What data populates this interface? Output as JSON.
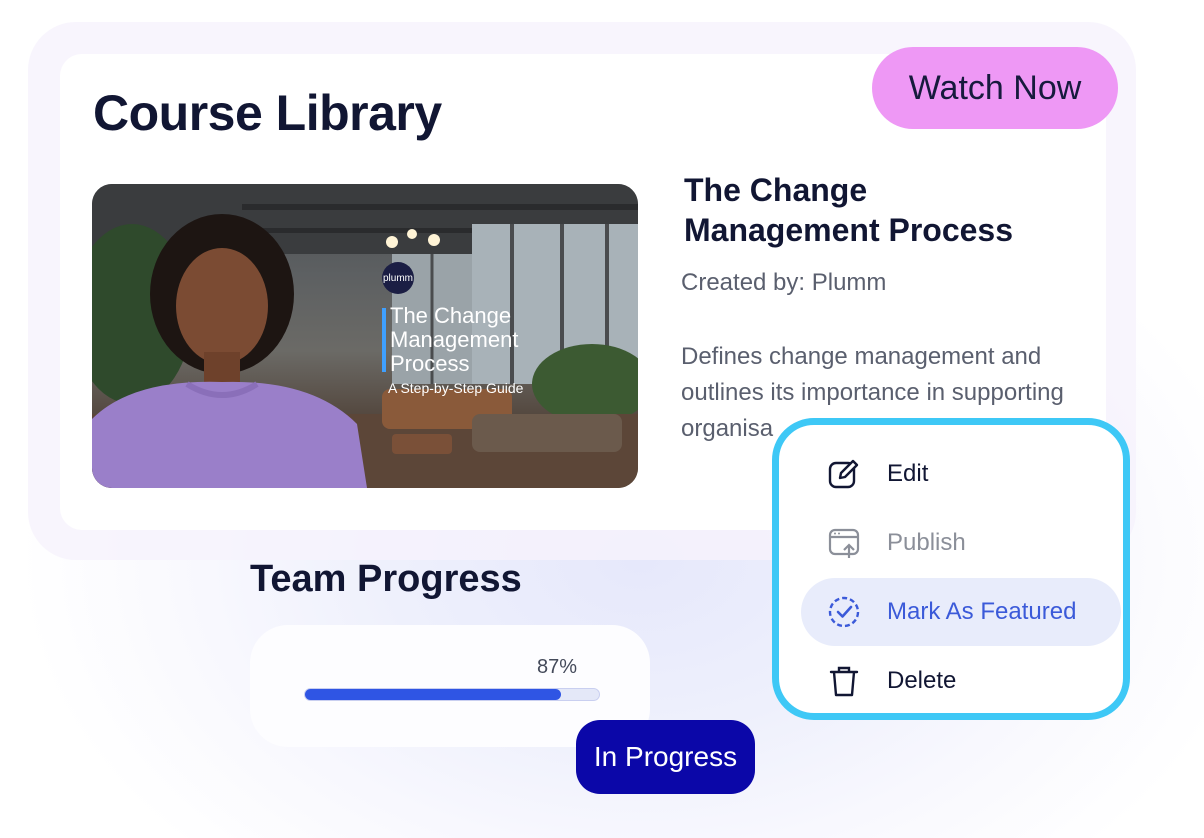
{
  "header": {
    "title": "Course Library",
    "cta_label": "Watch Now"
  },
  "course": {
    "name": "The Change Management Process",
    "creator": "Created by: Plumm",
    "description": "Defines change management and outlines its importance in supporting organisa",
    "thumbnail": {
      "logo_text": "plumm",
      "title_lines": [
        "The Change",
        "Management",
        "Process"
      ],
      "subtitle": "A Step-by-Step Guide"
    }
  },
  "context_menu": {
    "items": [
      {
        "label": "Edit",
        "icon": "edit-icon"
      },
      {
        "label": "Publish",
        "icon": "publish-icon"
      },
      {
        "label": "Mark As Featured",
        "icon": "featured-check-icon"
      },
      {
        "label": "Delete",
        "icon": "trash-icon"
      }
    ]
  },
  "team_progress": {
    "title": "Team Progress",
    "percent_label": "87%",
    "percent": 87,
    "status": "In Progress"
  },
  "colors": {
    "cta": "#ee98f5",
    "menu_border": "#3ec8f6",
    "featured_text": "#3b5ad9",
    "progress_fill": "#2f55e4",
    "status_badge": "#0b07a8",
    "heading": "#111633"
  }
}
